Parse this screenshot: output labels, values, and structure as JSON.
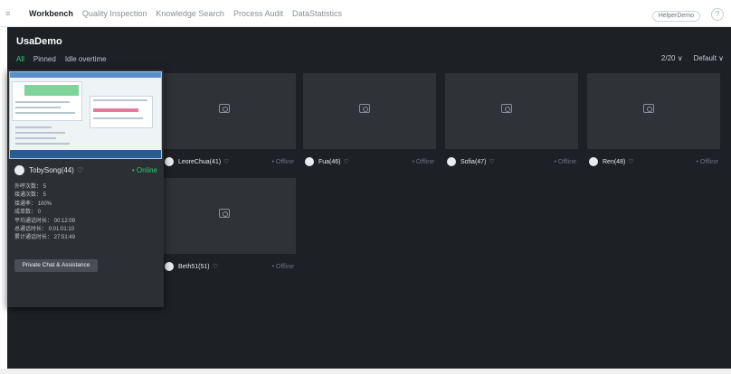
{
  "topnav": {
    "tabs": [
      {
        "label": "Workbench",
        "active": true
      },
      {
        "label": "Quality Inspection",
        "active": false
      },
      {
        "label": "Knowledge Search",
        "active": false
      },
      {
        "label": "Process Audit",
        "active": false
      },
      {
        "label": "DataStatistics",
        "active": false
      }
    ],
    "user_label": "HelperDemo",
    "help_glyph": "?"
  },
  "workspace": {
    "title": "UsaDemo",
    "filters": [
      {
        "label": "All",
        "active": true
      },
      {
        "label": "Pinned",
        "active": false
      },
      {
        "label": "Idle overtime",
        "active": false
      }
    ],
    "page_size": "2/20 ∨",
    "sort": "Default ∨"
  },
  "hover_card": {
    "name": "TobySong(44)",
    "status": "Online",
    "stats": [
      "外呼次数： 5",
      "接通次数： 5",
      "接通率： 100%",
      "成单数： 0",
      "平均通话时长： 00:12:09",
      "总通话时长： 0:01:01:10",
      "累计通话时长： 27:51:49"
    ],
    "chat_button": "Private Chat & Assistance"
  },
  "cards": [
    {
      "name": "LeoreChua(41)",
      "status": "Offline"
    },
    {
      "name": "Fua(46)",
      "status": "Offline"
    },
    {
      "name": "Sofia(47)",
      "status": "Offline"
    },
    {
      "name": "Ren(48)",
      "status": "Offline"
    },
    {
      "name": "Beth51(51)",
      "status": "Offline"
    }
  ],
  "colors": {
    "workspace_bg": "#1d2025",
    "thumb_bg": "#2f3236",
    "accent_green": "#2bd37e",
    "offline_gray": "#6d737a"
  }
}
